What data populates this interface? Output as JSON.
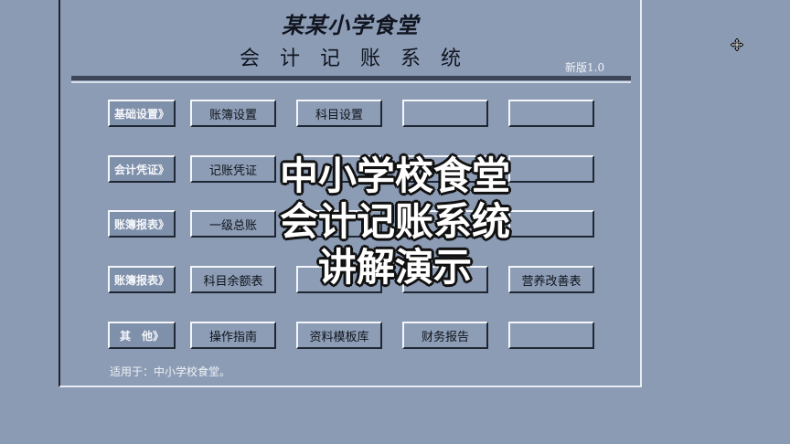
{
  "header": {
    "title": "某某小学食堂",
    "subtitle": "会计记账系统",
    "version": "新版1.0"
  },
  "rows": [
    {
      "category": "基础设置》",
      "buttons": [
        "账簿设置",
        "科目设置",
        "",
        ""
      ]
    },
    {
      "category": "会计凭证》",
      "buttons": [
        "记账凭证",
        "",
        "",
        ""
      ]
    },
    {
      "category": "账簿报表》",
      "buttons": [
        "一级总账",
        "",
        "",
        ""
      ]
    },
    {
      "category": "账簿报表》",
      "buttons": [
        "科目余额表",
        "",
        "",
        "营养改善表"
      ]
    },
    {
      "category": "其　他》",
      "buttons": [
        "操作指南",
        "资料模板库",
        "财务报告",
        ""
      ]
    }
  ],
  "footer": "适用于：中小学校食堂。",
  "overlay": {
    "lines": [
      "中小学校食堂",
      "会计记账系统",
      "讲解演示"
    ]
  },
  "cursor_icon": "move-cursor-icon"
}
